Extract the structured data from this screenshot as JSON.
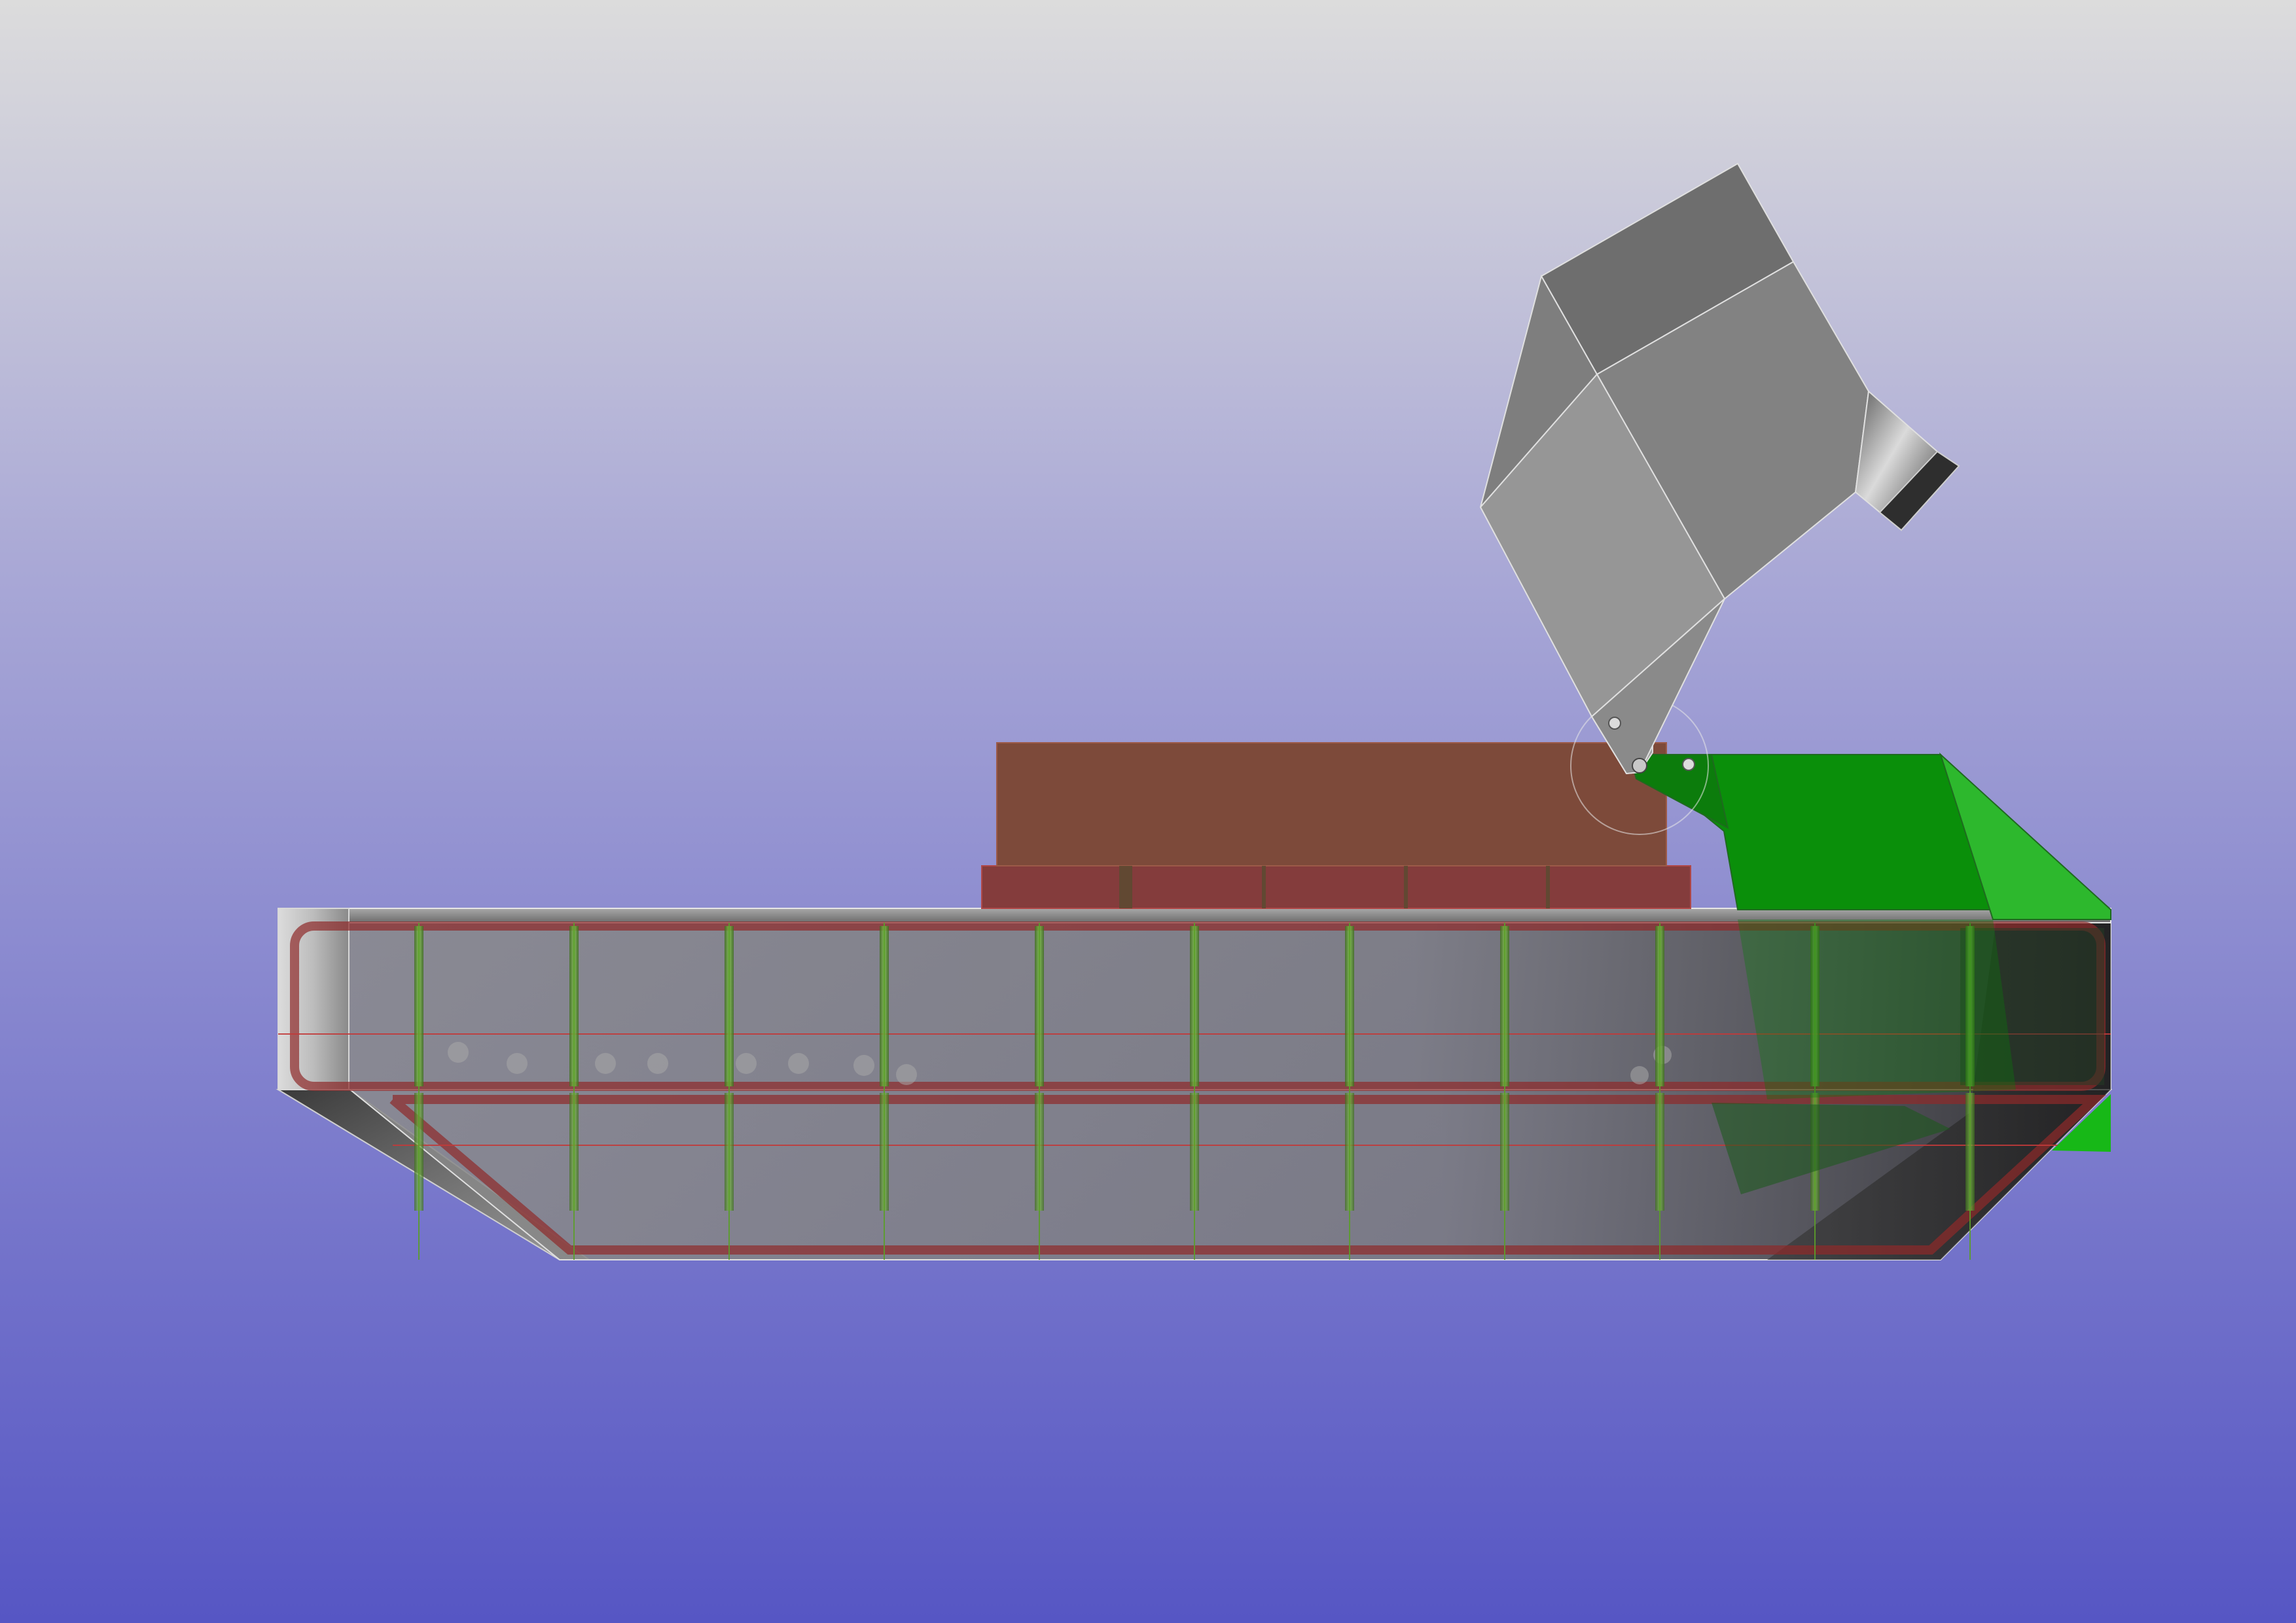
{
  "viewport": {
    "background_top_color": "#dcdcdc",
    "background_mid_color": "#a9a8d6",
    "background_bottom_color": "#5656c4"
  },
  "model": {
    "hull_color": "#808080",
    "hull_bulkhead_color": "#8e2a2a",
    "stiffener_color": "#5b9e2a",
    "deckhouse_color": "#7d4a3a",
    "deckhouse_base_color": "#843c3c",
    "chute_color": "#969696",
    "tipper_color": "#0a8f0a",
    "tipper_light_color": "#2db82d",
    "pivot_bracket_color": "#a0a0a0",
    "stiffener_count": 11
  },
  "icons": {
    "pivot": "pivot-joint-icon"
  }
}
